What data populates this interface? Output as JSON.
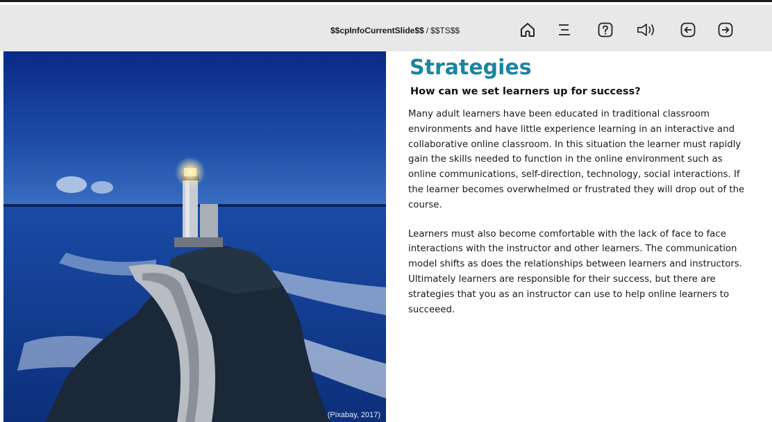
{
  "toolbar": {
    "slide_current": "$$cpInfoCurrentSlide$$",
    "slide_separator": "/",
    "slide_total": "$$TS$$",
    "buttons": [
      {
        "name": "home-icon"
      },
      {
        "name": "menu-icon"
      },
      {
        "name": "help-icon"
      },
      {
        "name": "audio-icon"
      },
      {
        "name": "back-icon"
      },
      {
        "name": "forward-icon"
      }
    ]
  },
  "image": {
    "credit": "(Pixabay, 2017)"
  },
  "content": {
    "title": "Strategies",
    "subtitle": "How can we set learners up for success?",
    "paragraph1": "Many adult learners have been educated in traditional classroom environments and have little experience learning in an interactive and collaborative online classroom. In this situation the learner must rapidly gain the skills needed to function in the online environment such as online communications, self-direction, technology, social interactions. If the learner becomes overwhelmed or frustrated they will drop out of the course.",
    "paragraph2": "Learners must also become comfortable with the lack of face to face interactions with the instructor and other learners. The communication model shifts as does the relationships between learners and instructors. Ultimately learners are responsible for their success, but there are strategies that you as an instructor can use to help online learners to succeeed."
  },
  "colors": {
    "title": "#1b84a4",
    "toolbar_bg": "#e8e8e8",
    "text": "#1a1a1a"
  }
}
